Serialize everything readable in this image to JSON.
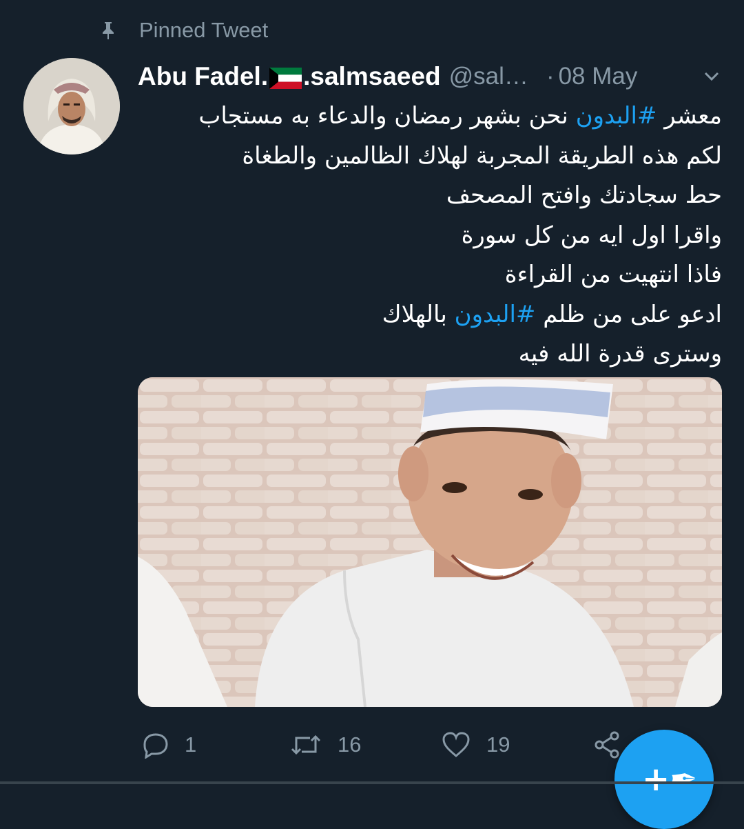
{
  "pinned_label": "Pinned Tweet",
  "tweet": {
    "name_part1": "Abu Fadel.",
    "name_part2": ".salmsaeed",
    "flag": "kuwait-flag",
    "handle": "@sal…",
    "separator": "·",
    "date": "08 May",
    "text_lines": [
      {
        "before": "معشر ",
        "hashtag": "#البدون",
        "after": " نحن بشهر رمضان والدعاء به مستجاب"
      },
      {
        "text": "لكم هذه الطريقة المجربة لهلاك الظالمين والطغاة"
      },
      {
        "text": "حط سجادتك وافتح المصحف"
      },
      {
        "text": "واقرا اول ايه من كل سورة"
      },
      {
        "text": "فاذا انتهيت من القراءة"
      },
      {
        "before": "ادعو على من ظلم ",
        "hashtag": "#البدون",
        "after": " بالهلاك"
      },
      {
        "text": "وسترى قدرة الله فيه"
      }
    ],
    "replies": "1",
    "retweets": "16",
    "likes": "19"
  },
  "colors": {
    "background": "#15202b",
    "accent": "#1da1f2",
    "muted": "#8899a6"
  },
  "icons": {
    "pin": "pin-icon",
    "chevron": "chevron-down-icon",
    "reply": "reply-icon",
    "retweet": "retweet-icon",
    "like": "heart-icon",
    "share": "share-icon",
    "compose": "compose-tweet-icon"
  }
}
